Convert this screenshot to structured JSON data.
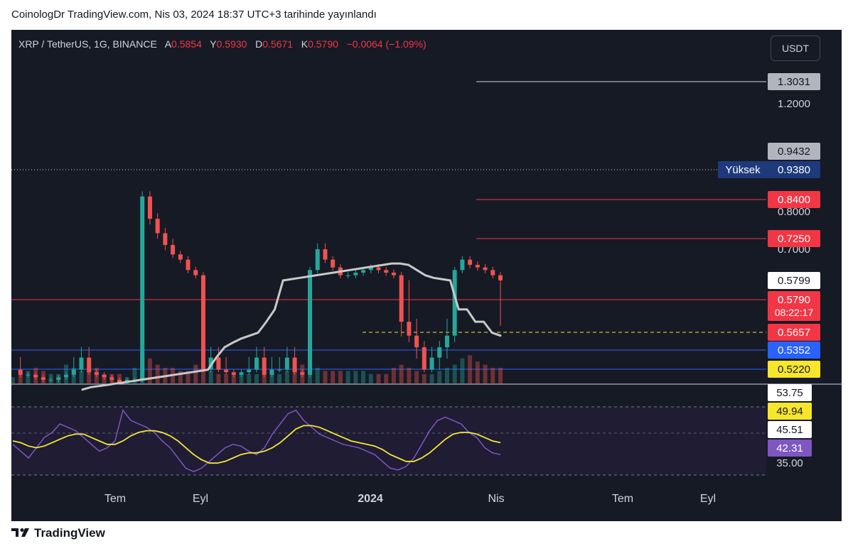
{
  "header": {
    "published": "CoinologDr TradingView.com, Nis 03, 2024 18:37 UTC+3 tarihinde yayınlandı"
  },
  "legend": {
    "symbol": "XRP / TetherUS, 1G, BINANCE",
    "open_label": "A",
    "open": "0.5854",
    "high_label": "Y",
    "high": "0.5930",
    "low_label": "D",
    "low": "0.5671",
    "close_label": "K",
    "close": "0.5790",
    "change": "−0.0064 (−1.09%)"
  },
  "currency_button": "USDT",
  "footer": {
    "brand": "TradingView"
  },
  "colors": {
    "background": "#161a25",
    "up": "#26a69a",
    "down": "#ef5350",
    "ma": "#c9c9c9",
    "rsi": "#7e57c2",
    "rsi_ma": "#f5e638",
    "red_level": "#f23645",
    "blue_level": "#2962ff",
    "yellow_level": "#f7e62b"
  },
  "chart_data": [
    {
      "type": "candlestick",
      "symbol": "XRP / TetherUS",
      "timeframe": "1G",
      "exchange": "BINANCE",
      "x_labels": [
        "Tem",
        "Eyl",
        "2024",
        "Nis",
        "Tem",
        "Eyl"
      ],
      "y_ticks": [
        1.2,
        0.8,
        0.7
      ],
      "price_axis_labels": [
        {
          "text": "1.3031",
          "style": "gray"
        },
        {
          "text": "0.9432",
          "style": "gray"
        },
        {
          "text": "0.9380",
          "tag": "Yüksek",
          "style": "navy"
        },
        {
          "text": "0.8400",
          "style": "red"
        },
        {
          "text": "0.7250",
          "style": "red"
        },
        {
          "text": "0.5799",
          "style": "white"
        },
        {
          "text": "0.5790",
          "style": "red",
          "countdown": "08:22:17"
        },
        {
          "text": "0.5657",
          "style": "red"
        },
        {
          "text": "0.5352",
          "style": "blue"
        },
        {
          "text": "0.5220",
          "style": "yellow"
        }
      ],
      "horizontal_levels": [
        {
          "value": 1.3031,
          "color": "white"
        },
        {
          "value": 0.938,
          "color": "white",
          "style": "dotted"
        },
        {
          "value": 0.84,
          "color": "red"
        },
        {
          "value": 0.725,
          "color": "red"
        },
        {
          "value": 0.579,
          "color": "red"
        },
        {
          "value": 0.5657,
          "color": "yellow",
          "style": "dashed"
        },
        {
          "value": 0.5352,
          "color": "blue"
        },
        {
          "value": 0.522,
          "color": "blue"
        }
      ],
      "price_series": [
        0.52,
        0.5,
        0.5,
        0.49,
        0.48,
        0.48,
        0.49,
        0.5,
        0.52,
        0.53,
        0.51,
        0.5,
        0.49,
        0.48,
        0.47,
        0.48,
        0.48,
        0.85,
        0.78,
        0.74,
        0.71,
        0.68,
        0.66,
        0.62,
        0.6,
        0.52,
        0.53,
        0.52,
        0.51,
        0.5,
        0.51,
        0.52,
        0.53,
        0.5,
        0.52,
        0.52,
        0.53,
        0.51,
        0.5,
        0.62,
        0.7,
        0.66,
        0.63,
        0.6,
        0.6,
        0.61,
        0.62,
        0.63,
        0.62,
        0.61,
        0.6,
        0.57,
        0.56,
        0.54,
        0.52,
        0.53,
        0.54,
        0.56,
        0.62,
        0.66,
        0.64,
        0.63,
        0.62,
        0.6,
        0.58
      ],
      "volume_series": [
        0.2,
        0.3,
        0.4,
        0.5,
        0.4,
        0.3,
        0.3,
        0.6,
        0.5,
        0.4,
        0.6,
        0.5,
        0.3,
        0.3,
        0.3,
        0.2,
        0.5,
        1.0,
        0.8,
        0.6,
        0.5,
        0.5,
        0.4,
        0.4,
        0.6,
        0.5,
        0.4,
        0.3,
        0.3,
        0.3,
        0.3,
        0.3,
        0.3,
        0.3,
        0.3,
        0.3,
        0.4,
        0.5,
        0.6,
        0.7,
        0.5,
        0.4,
        0.4,
        0.4,
        0.4,
        0.4,
        0.4,
        0.3,
        0.3,
        0.3,
        0.5,
        0.6,
        0.5,
        0.4,
        0.3,
        0.3,
        0.4,
        0.5,
        0.6,
        0.8,
        0.9,
        0.7,
        0.6,
        0.5,
        0.5
      ],
      "ma_series": [
        0.44,
        0.45,
        0.455,
        0.46,
        0.465,
        0.47,
        0.475,
        0.48,
        0.485,
        0.49,
        0.495,
        0.5,
        0.505,
        0.51,
        0.515,
        0.52,
        0.53,
        0.54,
        0.548,
        0.555,
        0.56,
        0.565,
        0.57,
        0.575,
        0.58,
        0.585,
        0.59,
        0.595,
        0.6,
        0.605,
        0.61,
        0.615,
        0.62,
        0.625,
        0.63,
        0.635,
        0.64,
        0.645,
        0.645,
        0.64,
        0.62,
        0.6,
        0.59,
        0.585,
        0.58,
        0.575,
        0.575,
        0.57,
        0.57,
        0.565,
        0.56
      ]
    },
    {
      "type": "line",
      "indicator": "RSI",
      "y_ticks": [
        53.75,
        49.94,
        45.51,
        42.31,
        35.0
      ],
      "rsi_series": [
        48,
        44,
        40,
        46,
        52,
        55,
        60,
        58,
        56,
        52,
        48,
        44,
        46,
        50,
        68,
        62,
        60,
        58,
        55,
        50,
        46,
        40,
        34,
        32,
        34,
        38,
        42,
        46,
        48,
        47,
        44,
        42,
        46,
        54,
        60,
        66,
        68,
        62,
        58,
        54,
        52,
        50,
        48,
        47,
        46,
        44,
        42,
        38,
        34,
        33,
        35,
        40,
        48,
        56,
        62,
        64,
        62,
        60,
        55,
        52,
        46,
        43,
        42
      ],
      "rsi_ma_series": [
        50,
        49,
        47,
        46,
        47,
        49,
        51,
        53,
        54,
        54,
        52,
        50,
        48,
        48,
        50,
        53,
        55,
        56,
        56,
        55,
        53,
        50,
        46,
        42,
        39,
        37,
        37,
        38,
        40,
        42,
        43,
        43,
        44,
        46,
        49,
        53,
        57,
        59,
        59,
        58,
        56,
        54,
        52,
        50,
        49,
        48,
        47,
        45,
        42,
        40,
        38,
        38,
        40,
        43,
        47,
        51,
        54,
        55,
        55,
        54,
        52,
        50,
        49
      ]
    }
  ]
}
